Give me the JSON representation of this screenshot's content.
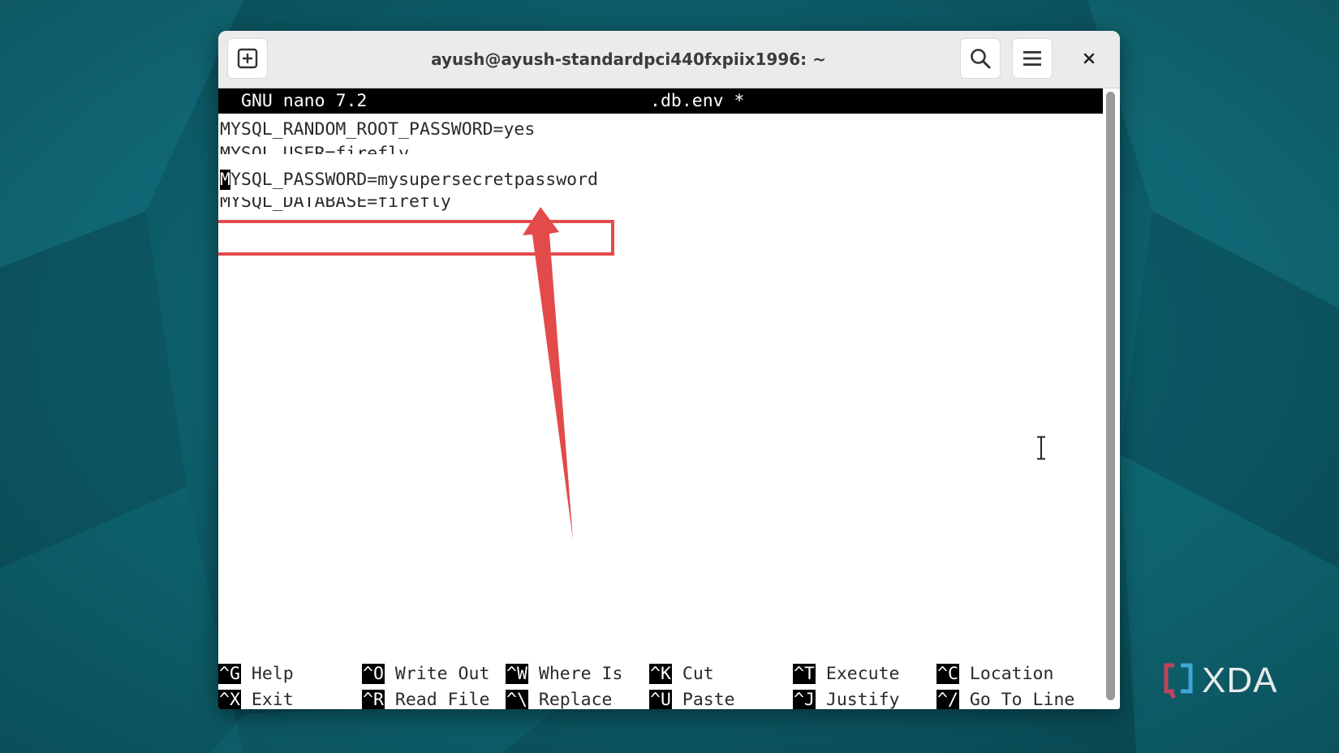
{
  "desktop": {
    "background_color": "#0d5560",
    "watermark": "XDA"
  },
  "window": {
    "title": "ayush@ayush-standardpci440fxpiix1996: ~",
    "buttons": {
      "new_tab_icon": "new-tab-plus-icon",
      "search_icon": "search-icon",
      "menu_icon": "hamburger-menu-icon",
      "close_icon": "close-icon"
    }
  },
  "nano": {
    "app_version": "GNU nano 7.2",
    "filename": ".db.env *",
    "lines": [
      "MYSQL_RANDOM_ROOT_PASSWORD=yes",
      "MYSQL_USER=firefly",
      "MYSQL_PASSWORD=mysupersecretpassword",
      "MYSQL_DATABASE=firefly"
    ],
    "cursor_char": "M",
    "line3_rest": "YSQL_PASSWORD=mysupersecretpassword",
    "shortcuts": [
      {
        "key": "^G",
        "label": "Help"
      },
      {
        "key": "^O",
        "label": "Write Out"
      },
      {
        "key": "^W",
        "label": "Where Is"
      },
      {
        "key": "^K",
        "label": "Cut"
      },
      {
        "key": "^T",
        "label": "Execute"
      },
      {
        "key": "^C",
        "label": "Location"
      },
      {
        "key": "^X",
        "label": "Exit"
      },
      {
        "key": "^R",
        "label": "Read File"
      },
      {
        "key": "^\\",
        "label": "Replace"
      },
      {
        "key": "^U",
        "label": "Paste"
      },
      {
        "key": "^J",
        "label": "Justify"
      },
      {
        "key": "^/",
        "label": "Go To Line"
      }
    ]
  },
  "annotation": {
    "color": "#e34a4a",
    "highlight_icon": "highlight-box",
    "arrow_icon": "pointer-arrow-icon"
  }
}
